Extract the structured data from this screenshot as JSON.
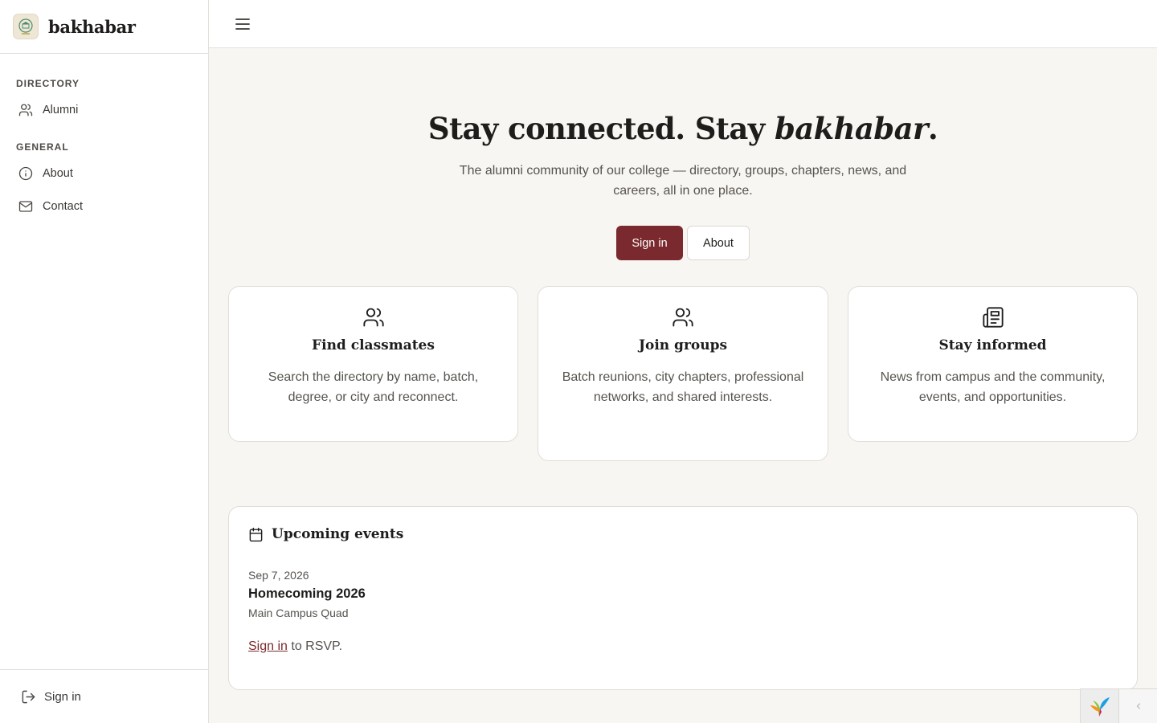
{
  "app": {
    "name": "bakhabar"
  },
  "sidebar": {
    "sections": [
      {
        "heading": "DIRECTORY",
        "items": [
          {
            "label": "Alumni",
            "icon": "users-icon"
          }
        ]
      },
      {
        "heading": "GENERAL",
        "items": [
          {
            "label": "About",
            "icon": "info-icon"
          },
          {
            "label": "Contact",
            "icon": "mail-icon"
          }
        ]
      }
    ],
    "footer": {
      "label": "Sign in",
      "icon": "sign-in-icon"
    }
  },
  "hero": {
    "title_plain": "Stay connected. Stay ",
    "title_emph": "bakhabar",
    "title_end": ".",
    "subtitle": "The alumni community of our college — directory, groups, chapters, news, and careers, all in one place.",
    "primary_button": "Sign in",
    "secondary_button": "About"
  },
  "features": [
    {
      "icon": "users-icon",
      "title": "Find classmates",
      "desc": "Search the directory by name, batch, degree, or city and reconnect."
    },
    {
      "icon": "users-icon",
      "title": "Join groups",
      "desc": "Batch reunions, city chapters, professional networks, and shared interests."
    },
    {
      "icon": "newspaper-icon",
      "title": "Stay informed",
      "desc": "News from campus and the community, events, and opportunities."
    }
  ],
  "events": {
    "title": "Upcoming events",
    "items": [
      {
        "date": "Sep 7, 2026",
        "name": "Homecoming 2026",
        "location": "Main Campus Quad"
      }
    ],
    "rsvp_link": "Sign in",
    "rsvp_text": " to RSVP."
  },
  "colors": {
    "accent": "#7a2a2e",
    "background": "#f8f6f2",
    "surface": "#ffffff",
    "border": "#e4e1dc"
  }
}
